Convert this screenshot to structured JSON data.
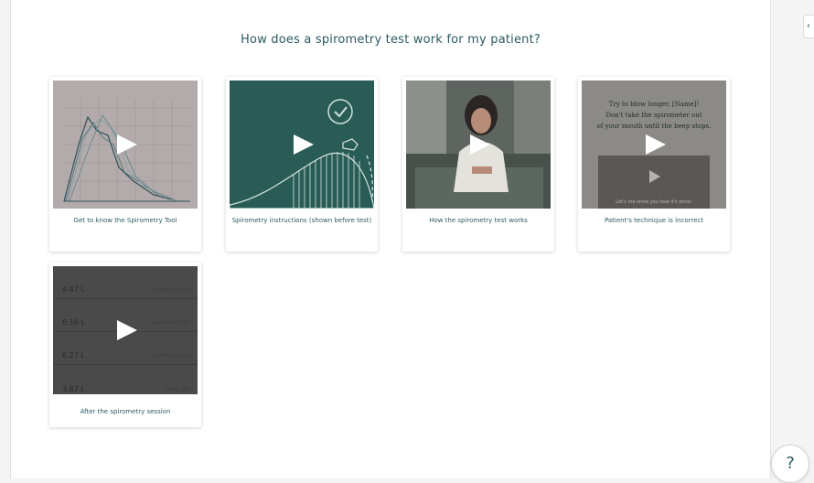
{
  "page": {
    "title": "How does a spirometry test work for my patient?"
  },
  "videos": [
    {
      "label": "Get to know the Spirometry Tool"
    },
    {
      "label": "Spirometry instructions (shown before test)"
    },
    {
      "label": "How the spirometry test works"
    },
    {
      "label": "Patient's technique is incorrect"
    },
    {
      "label": "After the spirometry session"
    }
  ],
  "thumb_technique": {
    "line1": "Try to blow longer, [Name]!",
    "line2": "Don't take the spirometer out",
    "line3": "of your mouth until the beep stops.",
    "inner_caption": "Let's me show you how it's done!"
  },
  "thumb_results": [
    {
      "value": "4.47 L",
      "date": "September 14, 2023"
    },
    {
      "value": "6.16 L",
      "date": "September 13, 2023"
    },
    {
      "value": "6.27 L",
      "date": "September 12, 2023"
    },
    {
      "value": "3.67 L",
      "date": "June 21, 2023"
    }
  ],
  "collapse_icon": "‹",
  "help_label": "?",
  "colors": {
    "accent": "#2c5a63",
    "teal_bg": "#2a5c56",
    "thumb_gray": "#b3abab",
    "results_bg": "#4a4a4a"
  }
}
